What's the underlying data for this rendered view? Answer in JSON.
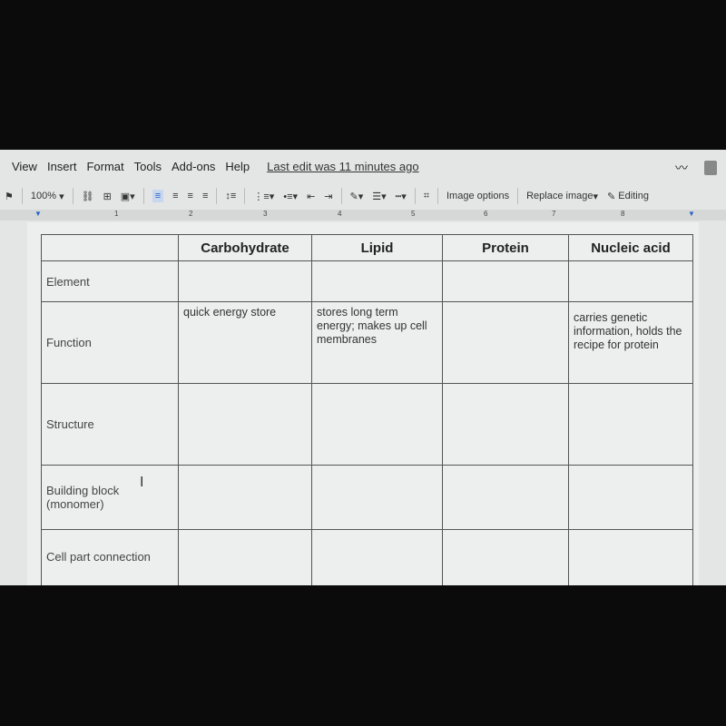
{
  "menu": {
    "items": [
      "View",
      "Insert",
      "Format",
      "Tools",
      "Add-ons",
      "Help"
    ],
    "last_edit": "Last edit was 11 minutes ago"
  },
  "toolbar": {
    "zoom": "100%",
    "image_options": "Image options",
    "replace_image": "Replace image",
    "editing": "Editing"
  },
  "ruler": {
    "labels": [
      "1",
      "2",
      "3",
      "4",
      "5",
      "6",
      "7",
      "8"
    ]
  },
  "table": {
    "headers": [
      "",
      "Carbohydrate",
      "Lipid",
      "Protein",
      "Nucleic acid"
    ],
    "rows": [
      {
        "label": "Element",
        "cells": [
          "",
          "",
          "",
          ""
        ]
      },
      {
        "label": "Function",
        "cells": [
          "quick energy store",
          "stores long term energy; makes up cell membranes",
          "",
          "carries genetic information, holds the recipe for protein"
        ]
      },
      {
        "label": "Structure",
        "cells": [
          "",
          "",
          "",
          ""
        ]
      },
      {
        "label": "Building block (monomer)",
        "cells": [
          "",
          "",
          "",
          ""
        ]
      },
      {
        "label": "Cell part connection",
        "cells": [
          "",
          "",
          "",
          ""
        ]
      }
    ]
  }
}
